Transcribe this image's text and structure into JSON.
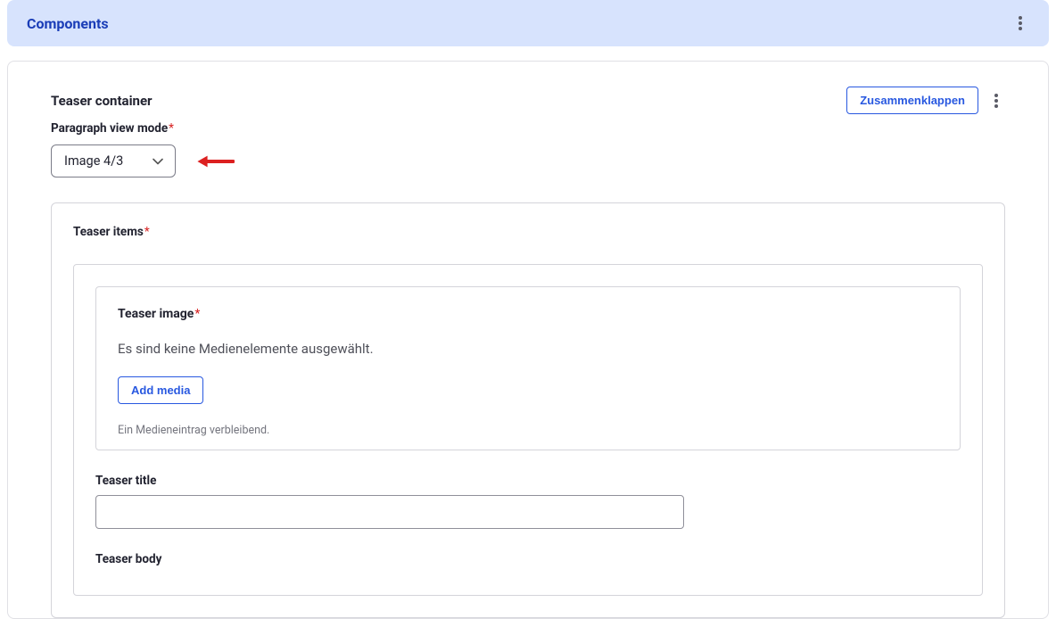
{
  "header": {
    "title": "Components"
  },
  "teaserContainer": {
    "title": "Teaser container",
    "collapseLabel": "Zusammenklappen",
    "viewMode": {
      "label": "Paragraph view mode",
      "value": "Image 4/3"
    },
    "teaserItems": {
      "label": "Teaser items",
      "item": {
        "teaserImage": {
          "label": "Teaser image",
          "emptyText": "Es sind keine Medienelemente ausgewählt.",
          "addButton": "Add media",
          "hint": "Ein Medieneintrag verbleibend."
        },
        "teaserTitle": {
          "label": "Teaser title",
          "value": ""
        },
        "teaserBody": {
          "label": "Teaser body"
        }
      }
    }
  }
}
